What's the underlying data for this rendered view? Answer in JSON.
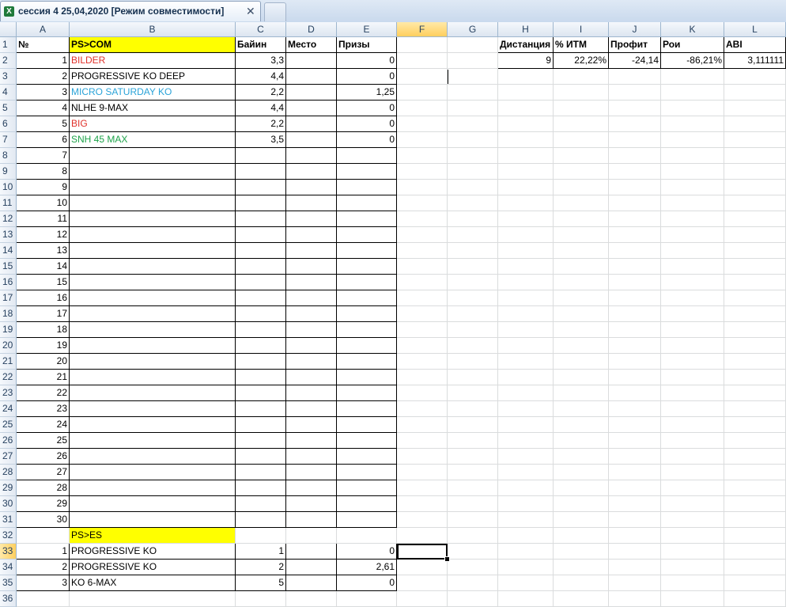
{
  "window": {
    "doc_title": "сессия 4 25,04,2020  [Режим совместимости]",
    "excel_icon_glyph": "X",
    "close_glyph": "✕"
  },
  "columns": [
    "A",
    "B",
    "C",
    "D",
    "E",
    "F",
    "G",
    "H",
    "I",
    "J",
    "K",
    "L"
  ],
  "selected_column": "F",
  "selected_row": 33,
  "row_numbers": [
    1,
    2,
    3,
    4,
    5,
    6,
    7,
    8,
    9,
    10,
    11,
    12,
    13,
    14,
    15,
    16,
    17,
    18,
    19,
    20,
    21,
    22,
    23,
    24,
    25,
    26,
    27,
    28,
    29,
    30,
    31,
    32,
    33,
    34,
    35,
    36
  ],
  "headers": {
    "num": "№",
    "section1": "PS>COM",
    "buyin": "Байин",
    "place": "Место",
    "prizes": "Призы"
  },
  "section1_rows": [
    {
      "n": "1",
      "name": "BILDER",
      "buyin": "3,3",
      "place": "",
      "prize": "0",
      "color": "red"
    },
    {
      "n": "2",
      "name": "PROGRESSIVE KO DEEP",
      "buyin": "4,4",
      "place": "",
      "prize": "0",
      "color": ""
    },
    {
      "n": "3",
      "name": "MICRO SATURDAY KO",
      "buyin": "2,2",
      "place": "",
      "prize": "1,25",
      "color": "cyan"
    },
    {
      "n": "4",
      "name": "NLHE 9-MAX",
      "buyin": "4,4",
      "place": "",
      "prize": "0",
      "color": ""
    },
    {
      "n": "5",
      "name": "BIG",
      "buyin": "2,2",
      "place": "",
      "prize": "0",
      "color": "red"
    },
    {
      "n": "6",
      "name": "SNH 45 MAX",
      "buyin": "3,5",
      "place": "",
      "prize": "0",
      "color": "green"
    }
  ],
  "empty_numbers": [
    "7",
    "8",
    "9",
    "10",
    "11",
    "12",
    "13",
    "14",
    "15",
    "16",
    "17",
    "18",
    "19",
    "20",
    "21",
    "22",
    "23",
    "24",
    "25",
    "26",
    "27",
    "28",
    "29",
    "30"
  ],
  "section2_label": "PS>ES",
  "section2_rows": [
    {
      "n": "1",
      "name": "PROGRESSIVE KO",
      "buyin": "1",
      "place": "",
      "prize": "0"
    },
    {
      "n": "2",
      "name": "PROGRESSIVE KO",
      "buyin": "2",
      "place": "",
      "prize": "2,61"
    },
    {
      "n": "3",
      "name": "KO 6-MAX",
      "buyin": "5",
      "place": "",
      "prize": "0"
    }
  ],
  "stats": {
    "headers": [
      "Дистанция",
      "% ИТМ",
      "Профит",
      "Рои",
      "ABI"
    ],
    "values": [
      "9",
      "22,22%",
      "-24,14",
      "-86,21%",
      "3,111111"
    ]
  }
}
